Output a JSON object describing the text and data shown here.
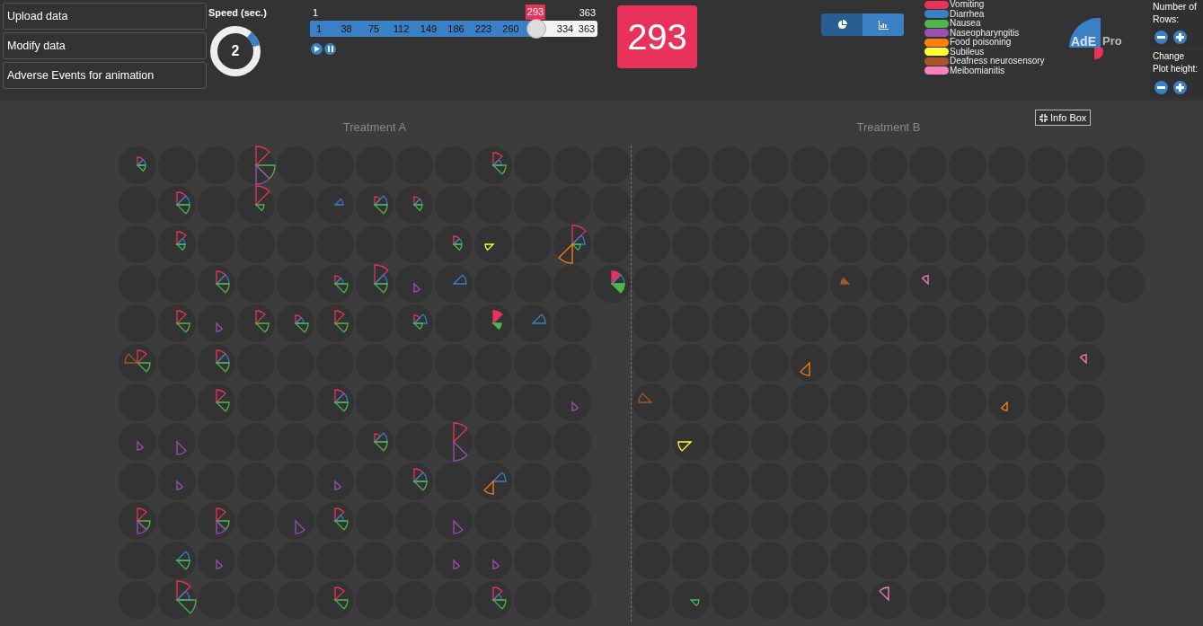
{
  "sidebar": {
    "buttons": [
      "Upload data",
      "Modify data",
      "Adverse Events for animation"
    ]
  },
  "speed": {
    "label": "Speed (sec.)",
    "value": "2",
    "level": 0.1
  },
  "slider": {
    "start_label": "1",
    "current_label": "293",
    "end_label": "363",
    "level": 0.787,
    "ticks": [
      "1",
      "38",
      "75",
      "112",
      "149",
      "186",
      "223",
      "260",
      "334",
      "363"
    ]
  },
  "current_day": "293",
  "view_toggle": [
    {
      "kind": "pie",
      "selected": true
    },
    {
      "kind": "bar",
      "selected": false
    }
  ],
  "legend": [
    {
      "label": "Vomiting",
      "color": "#e8325a"
    },
    {
      "label": "Diarrhea",
      "color": "#3a80c4"
    },
    {
      "label": "Nausea",
      "color": "#4cb84c"
    },
    {
      "label": "Naseopharyngitis",
      "color": "#9b4fb0"
    },
    {
      "label": "Food poisoning",
      "color": "#ff7f0e"
    },
    {
      "label": "Subileus",
      "color": "#ffff33"
    },
    {
      "label": "Deafness neurosensory",
      "color": "#a65628"
    },
    {
      "label": "Meibomianitis",
      "color": "#f781bf"
    }
  ],
  "logo": {
    "part_1": "AdE",
    "part_2": "Pro"
  },
  "rows_control": {
    "label": "Number of Rows:"
  },
  "height_control": {
    "label": "Change Plot height:"
  },
  "info_box": "Info Box",
  "treatments": [
    "Treatment A",
    "Treatment B"
  ]
}
